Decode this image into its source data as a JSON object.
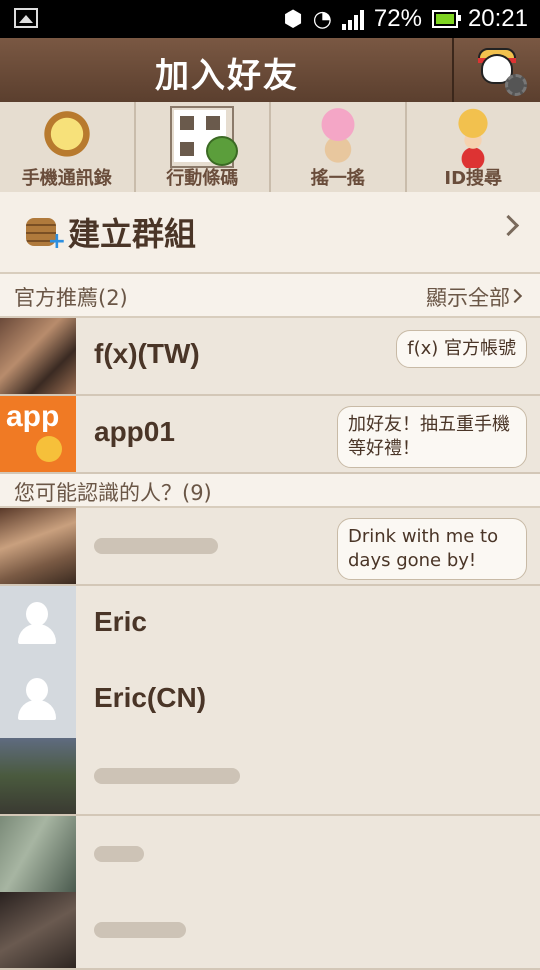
{
  "status_bar": {
    "battery_text": "72%",
    "time": "20:21"
  },
  "header": {
    "title": "加入好友"
  },
  "tabs": [
    {
      "label": "手機通訊錄"
    },
    {
      "label": "行動條碼"
    },
    {
      "label": "搖一搖"
    },
    {
      "label": "ID搜尋"
    }
  ],
  "create_group": {
    "label": "建立群組"
  },
  "official": {
    "title": "官方推薦(2)",
    "show_all": "顯示全部",
    "items": [
      {
        "name": "f(x)(TW)",
        "message": "f(x) 官方帳號"
      },
      {
        "name": "app01",
        "message": "加好友！抽五重手機等好禮！"
      }
    ]
  },
  "may_know": {
    "title": "您可能認識的人？(9)",
    "items": [
      {
        "name": "",
        "message": "Drink with me to days gone by!"
      },
      {
        "name": "Eric",
        "message": ""
      },
      {
        "name": "Eric(CN)",
        "message": ""
      },
      {
        "name": "",
        "message": ""
      },
      {
        "name": "",
        "message": ""
      },
      {
        "name": "",
        "message": ""
      }
    ]
  }
}
